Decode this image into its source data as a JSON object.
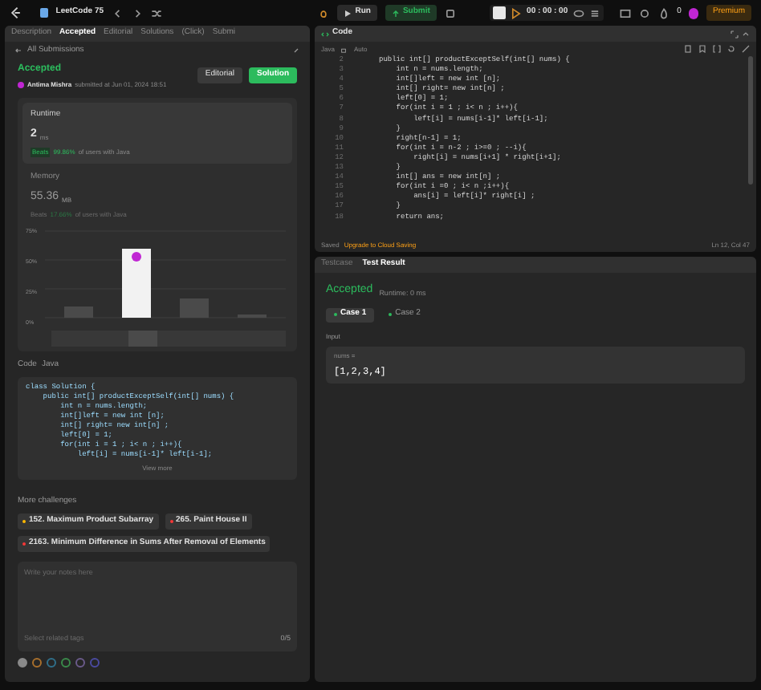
{
  "topbar": {
    "title": "LeetCode 75",
    "run": "Run",
    "submit": "Submit",
    "timer": "00 : 00 : 00",
    "streak": "0",
    "premium": "Premium"
  },
  "left_tabs": [
    {
      "label": "Description",
      "selected": false
    },
    {
      "label": "Accepted",
      "selected": true
    },
    {
      "label": "Editorial",
      "selected": false
    },
    {
      "label": "Solutions",
      "selected": false
    },
    {
      "label": "(Click)",
      "selected": false
    },
    {
      "label": "Submi",
      "selected": false
    }
  ],
  "back_link": "All Submissions",
  "submission": {
    "status": "Accepted",
    "user": "Antima Mishra",
    "submitted": "submitted at Jun 01, 2024 18:51",
    "editorial": "Editorial",
    "solution": "Solution"
  },
  "runtime": {
    "title": "Runtime",
    "value": "2",
    "unit": "ms",
    "beats": "Beats",
    "percent": "99.86%",
    "suffix": "of users with Java"
  },
  "memory": {
    "title": "Memory",
    "value": "55.36",
    "unit": "MB",
    "beats": "Beats",
    "percent": "17.66%",
    "suffix": "of users with Java",
    "y_labels": [
      "75%",
      "50%",
      "25%",
      "0%"
    ]
  },
  "code_header": {
    "label": "Code",
    "language": "Java"
  },
  "code_preview": [
    "class Solution {",
    "    public int[] productExceptSelf(int[] nums) {",
    "        int n = nums.length;",
    "        int[]left = new int [n];",
    "        int[] right= new int[n] ;",
    "        left[0] = 1;",
    "        for(int i = 1 ; i< n ; i++){",
    "            left[i] = nums[i-1]* left[i-1];"
  ],
  "view_more": "View more",
  "more_challenges": {
    "title": "More challenges",
    "items": [
      {
        "label": "152. Maximum Product Subarray",
        "color": "#ffb800"
      },
      {
        "label": "265. Paint House II",
        "color": "#f63737"
      },
      {
        "label": "2163. Minimum Difference in Sums After Removal of Elements",
        "color": "#f63737"
      }
    ]
  },
  "notes": {
    "placeholder": "Write your notes here",
    "tags": "Select related tags",
    "count": "0/5",
    "colors": [
      {
        "color": "#8a8a8a",
        "selected": true
      },
      {
        "color": "#a86f2c",
        "selected": false
      },
      {
        "color": "#2f6f8a",
        "selected": false
      },
      {
        "color": "#3a8a4a",
        "selected": false
      },
      {
        "color": "#6a5a8a",
        "selected": false
      },
      {
        "color": "#4a4aa0",
        "selected": false
      }
    ]
  },
  "editor": {
    "title": "Code",
    "language": "Java",
    "mode": "Auto",
    "lines": [
      {
        "no": "2",
        "text": "public int[] productExceptSelf(int[] nums) {"
      },
      {
        "no": "3",
        "text": "    int n = nums.length;"
      },
      {
        "no": "4",
        "text": "    int[]left = new int [n];"
      },
      {
        "no": "5",
        "text": "    int[] right= new int[n] ;"
      },
      {
        "no": "6",
        "text": "    left[0] = 1;"
      },
      {
        "no": "7",
        "text": "    for(int i = 1 ; i< n ; i++){"
      },
      {
        "no": "8",
        "text": "        left[i] = nums[i-1]* left[i-1];"
      },
      {
        "no": "9",
        "text": "    }"
      },
      {
        "no": "10",
        "text": "    right[n-1] = 1;"
      },
      {
        "no": "11",
        "text": "    for(int i = n-2 ; i>=0 ; --i){"
      },
      {
        "no": "12",
        "text": "        right[i] = nums[i+1] * right[i+1];"
      },
      {
        "no": "13",
        "text": "    }"
      },
      {
        "no": "14",
        "text": "    int[] ans = new int[n] ;"
      },
      {
        "no": "15",
        "text": "    for(int i =0 ; i< n ;i++){"
      },
      {
        "no": "16",
        "text": "        ans[i] = left[i]* right[i] ;"
      },
      {
        "no": "17",
        "text": "    }"
      },
      {
        "no": "18",
        "text": "    return ans;"
      }
    ],
    "saved": "Saved",
    "upgrade": "Upgrade to Cloud Saving",
    "position": "Ln 12, Col 47"
  },
  "test_tabs": [
    {
      "label": "Testcase",
      "selected": false
    },
    {
      "label": "Test Result",
      "selected": true
    }
  ],
  "result": {
    "status": "Accepted",
    "runtime": "Runtime: 0 ms",
    "cases": [
      {
        "label": "Case 1",
        "selected": true
      },
      {
        "label": "Case 2",
        "selected": false
      }
    ],
    "input_label": "Input",
    "param": "nums =",
    "value": "[1,2,3,4]"
  }
}
